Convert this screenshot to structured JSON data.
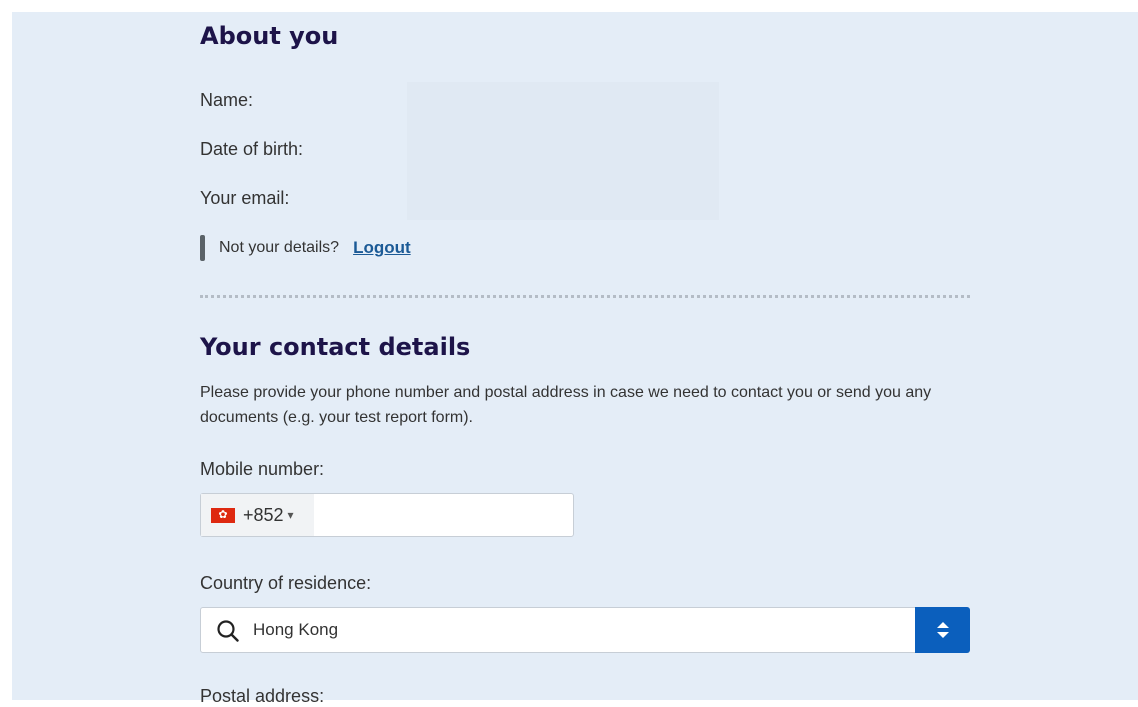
{
  "about": {
    "heading": "About you",
    "name_label": "Name:",
    "dob_label": "Date of birth:",
    "email_label": "Your email:",
    "not_details_text": "Not your details?",
    "logout_label": "Logout"
  },
  "contact": {
    "heading": "Your contact details",
    "intro": "Please provide your phone number and postal address in case we need to contact you or send you any documents (e.g. your test report form).",
    "mobile_label": "Mobile number:",
    "dial_code": "+852",
    "phone_value": "",
    "country_label": "Country of residence:",
    "country_value": "Hong Kong",
    "postal_label": "Postal address:"
  },
  "icons": {
    "flag": "hong-kong-flag-icon",
    "dial_caret": "caret-down-icon",
    "search": "search-icon",
    "select_toggle": "up-down-chevron-icon"
  },
  "colors": {
    "heading": "#1d1449",
    "link": "#1b5a96",
    "accent_button": "#0b5fbd",
    "panel_background": "#e4edf7"
  }
}
